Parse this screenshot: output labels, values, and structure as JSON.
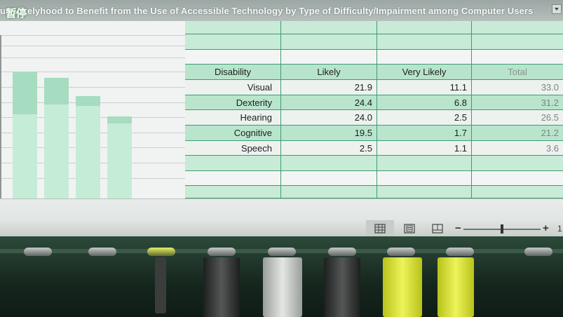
{
  "title": {
    "text": "un Likelyhood to Benefit from the Use of Accessible Technology by Type of Difficulty/Impairment among Computer Users",
    "paused_badge": "暂停"
  },
  "table": {
    "headers": [
      "Disability",
      "Likely",
      "Very Likely",
      "Total"
    ],
    "rows": [
      {
        "disability": "Visual",
        "likely": "21.9",
        "very_likely": "11.1",
        "total": "33.0"
      },
      {
        "disability": "Dexterity",
        "likely": "24.4",
        "very_likely": "6.8",
        "total": "31.2"
      },
      {
        "disability": "Hearing",
        "likely": "24.0",
        "very_likely": "2.5",
        "total": "26.5"
      },
      {
        "disability": "Cognitive",
        "likely": "19.5",
        "very_likely": "1.7",
        "total": "21.2"
      },
      {
        "disability": "Speech",
        "likely": "2.5",
        "very_likely": "1.1",
        "total": "3.6"
      }
    ]
  },
  "chart_bars": [
    {
      "likely": 21.9,
      "very_likely": 11.1
    },
    {
      "likely": 24.4,
      "very_likely": 6.8
    },
    {
      "likely": 24.0,
      "very_likely": 2.5
    },
    {
      "likely": 19.5,
      "very_likely": 1.7
    }
  ],
  "statusbar": {
    "zoom_minus": "−",
    "zoom_plus": "+",
    "zoom_value": "1",
    "zoom_level_fraction": 0.5
  },
  "colors": {
    "accent_green": "#3f9b74",
    "cell_green": "#b9e5cd",
    "bar_light": "#c5ecd7",
    "bar_dark": "#a6dcc0"
  },
  "icons": [
    "normal-view-icon",
    "page-layout-icon",
    "page-break-preview-icon",
    "chevron-down-icon"
  ]
}
